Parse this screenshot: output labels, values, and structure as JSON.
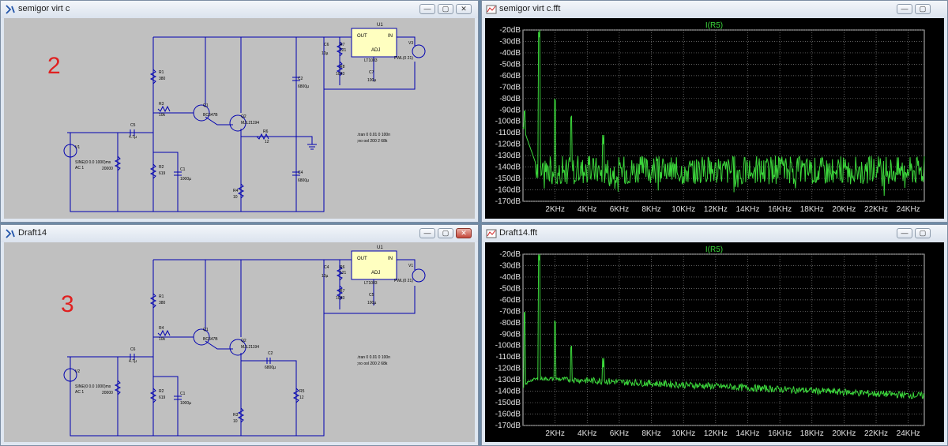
{
  "windows": {
    "sch_top": {
      "title": "semigor virt c",
      "label": "2"
    },
    "fft_top": {
      "title": "semigor virt c.fft",
      "trace": "I(R5)"
    },
    "sch_bot": {
      "title": "Draft14",
      "label": "3"
    },
    "fft_bot": {
      "title": "Draft14.fft",
      "trace": "I(R5)"
    }
  },
  "window_buttons": {
    "minimize": "—",
    "maximize": "▢",
    "close": "✕"
  },
  "fft_axes": {
    "y_ticks": [
      "-20dB",
      "-30dB",
      "-40dB",
      "-50dB",
      "-60dB",
      "-70dB",
      "-80dB",
      "-90dB",
      "-100dB",
      "-110dB",
      "-120dB",
      "-130dB",
      "-140dB",
      "-150dB",
      "-160dB",
      "-170dB"
    ],
    "x_ticks": [
      "2KHz",
      "4KHz",
      "6KHz",
      "8KHz",
      "10KHz",
      "12KHz",
      "14KHz",
      "16KHz",
      "18KHz",
      "20KHz",
      "22KHz",
      "24KHz"
    ]
  },
  "chart_data": [
    {
      "type": "line",
      "title": "I(R5)",
      "xlim_khz": [
        0,
        25
      ],
      "ylim_db": [
        -170,
        -20
      ],
      "grid": true,
      "peaks": [
        {
          "x_khz": 0.1,
          "y_db": -95
        },
        {
          "x_khz": 1.0,
          "y_db": -28
        },
        {
          "x_khz": 2.0,
          "y_db": -85
        },
        {
          "x_khz": 3.0,
          "y_db": -100
        },
        {
          "x_khz": 5.0,
          "y_db": -120
        }
      ],
      "noise_floor_db": [
        -155,
        -130
      ],
      "color": "#3cd83c"
    },
    {
      "type": "line",
      "title": "I(R5)",
      "xlim_khz": [
        0,
        25
      ],
      "ylim_db": [
        -170,
        -20
      ],
      "grid": true,
      "peaks": [
        {
          "x_khz": 0.1,
          "y_db": -75
        },
        {
          "x_khz": 1.0,
          "y_db": -27
        },
        {
          "x_khz": 2.0,
          "y_db": -83
        },
        {
          "x_khz": 3.0,
          "y_db": -105
        },
        {
          "x_khz": 5.0,
          "y_db": -119
        }
      ],
      "noise_floor_db": [
        -150,
        -130
      ],
      "color": "#3cd83c"
    }
  ],
  "schematic_top": {
    "labels": {
      "u1": "U1",
      "ic_model": "LT1083",
      "out": "OUT",
      "in": "IN",
      "adj": "ADJ",
      "r1": "R1",
      "r1v": "380",
      "r2": "R2",
      "r2v": "619",
      "r3": "R3",
      "r3v": "10k",
      "r4": "R4",
      "r4v": "10",
      "r6": "R6",
      "r6v": "12",
      "r7": "R7",
      "r7v": "121",
      "r8": "R8",
      "r8v": "1043",
      "q1": "Q1",
      "q1m": "BC647B",
      "q2": "Q2",
      "q2m": "MJL21194",
      "c1": "C1",
      "c1v": "1000µ",
      "c2": "C2",
      "c2v": "6800µ",
      "c4": "C4",
      "c4v": "6800µ",
      "c5": "C5",
      "c5v": "4.7µ",
      "c6": "C6",
      "c6v": "10µ",
      "c7": "C7",
      "c7v": "100µ",
      "v1": "V1",
      "v1a": "SINE(0 0.0 1000)ms",
      "v1b": "AC 1",
      "v3": "V3",
      "v3v": "PWL(0 21)",
      "r20000": "20000",
      "tran": ".tran 0 0.01 0 100n",
      "fourier": ";no ool 200 2 68k"
    }
  },
  "schematic_bot": {
    "labels": {
      "u1": "U1",
      "ic_model": "LT1083",
      "out": "OUT",
      "in": "IN",
      "adj": "ADJ",
      "r1": "R1",
      "r1v": "380",
      "r2": "R2",
      "r2v": "619",
      "r4": "R4",
      "r4v": "10k",
      "r3": "R3",
      "r3v": "10",
      "r5": "R5",
      "r5v": "12",
      "r6": "R6",
      "r6v": "121",
      "r7": "R7",
      "r7v": "1043",
      "q1": "Q1",
      "q1m": "BC647B",
      "q2": "Q2",
      "q2m": "MJL21194",
      "c1": "C1",
      "c1v": "1000µ",
      "c2": "C2",
      "c2v": "6800µ",
      "c4": "C4",
      "c4v": "10µ",
      "c5": "C5",
      "c5v": "100µ",
      "c6": "C6",
      "c6v": "4.7µ",
      "v2": "V2",
      "v2a": "SINE(0 0.0 1000)ms",
      "v2b": "AC 1",
      "v1": "V1",
      "v1v": "PWL(0 21)",
      "r20000": "20000",
      "tran": ".tran 0 0.01 0 100n",
      "fourier": ";no ool 200 2 68k"
    }
  }
}
